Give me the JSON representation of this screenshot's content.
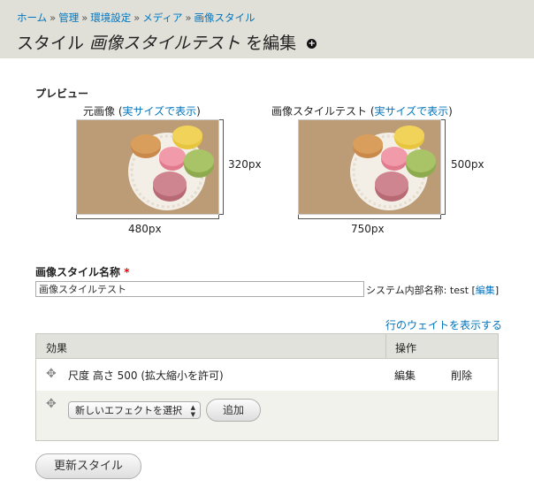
{
  "breadcrumb": {
    "items": [
      "ホーム",
      "管理",
      "環境設定",
      "メディア",
      "画像スタイル"
    ],
    "separator": "»"
  },
  "title": {
    "prefix": "スタイル",
    "name": "画像スタイルテスト",
    "suffix": "を編集"
  },
  "preview": {
    "label": "プレビュー",
    "original": {
      "caption": "元画像",
      "link": "実サイズで表示",
      "width_label": "480px",
      "height_label": "320px"
    },
    "derivative": {
      "caption": "画像スタイルテスト",
      "link": "実サイズで表示",
      "width_label": "750px",
      "height_label": "500px"
    }
  },
  "name_field": {
    "label": "画像スタイル名称",
    "required_mark": "*",
    "value": "画像スタイルテスト",
    "machine_name_label": "システム内部名称:",
    "machine_name": "test",
    "edit_link": "編集"
  },
  "weights_link": "行のウェイトを表示する",
  "effects_table": {
    "headers": [
      "効果",
      "操作"
    ],
    "rows": [
      {
        "effect": "尺度 高さ 500 (拡大縮小を許可)",
        "edit": "編集",
        "delete": "削除"
      }
    ],
    "new_effect_select": "新しいエフェクトを選択",
    "add_button": "追加"
  },
  "update_button": "更新スタイル",
  "colors": {
    "link": "#0074bd",
    "header_bg": "#e0e0d8",
    "required": "#ee0000"
  }
}
